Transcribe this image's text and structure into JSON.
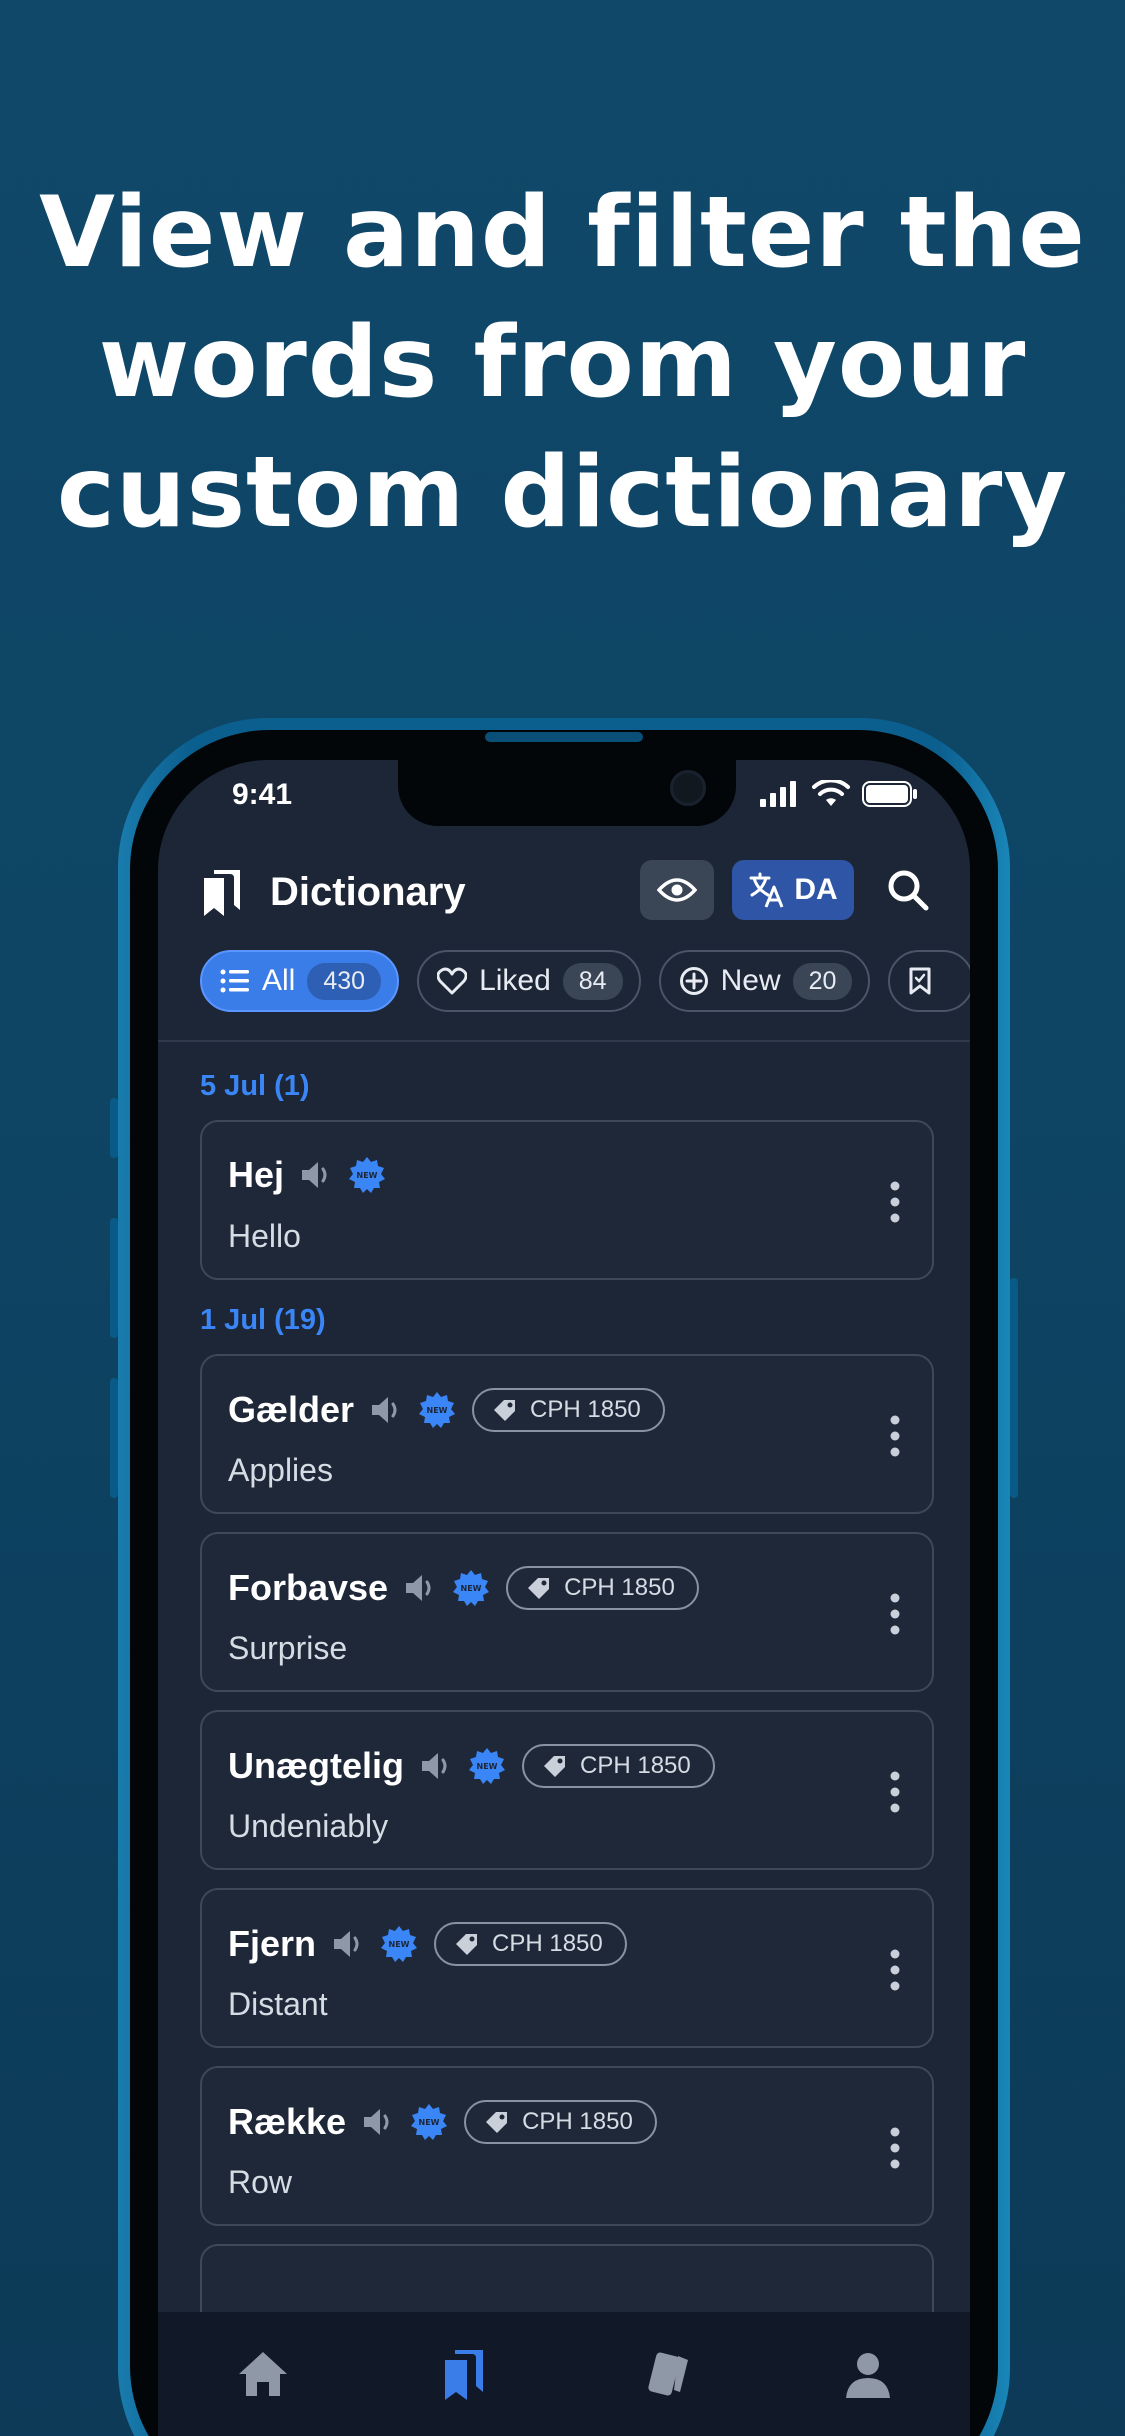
{
  "headline": {
    "line1": "View and filter the",
    "line2": "words from your",
    "line3": "custom dictionary"
  },
  "status": {
    "time": "9:41"
  },
  "header": {
    "title": "Dictionary",
    "lang_label": "DA"
  },
  "filters": [
    {
      "label": "All",
      "count": "430",
      "icon": "list-icon"
    },
    {
      "label": "Liked",
      "count": "84",
      "icon": "heart-icon"
    },
    {
      "label": "New",
      "count": "20",
      "icon": "plus-circle-icon"
    }
  ],
  "groups": [
    {
      "date": "5 Jul (1)",
      "entries": [
        {
          "word": "Hej",
          "translation": "Hello",
          "tag": ""
        }
      ]
    },
    {
      "date": "1 Jul (19)",
      "entries": [
        {
          "word": "Gælder",
          "translation": "Applies",
          "tag": "CPH 1850"
        },
        {
          "word": "Forbavse",
          "translation": "Surprise",
          "tag": "CPH 1850"
        },
        {
          "word": "Unægtelig",
          "translation": "Undeniably",
          "tag": "CPH 1850"
        },
        {
          "word": "Fjern",
          "translation": "Distant",
          "tag": "CPH 1850"
        },
        {
          "word": "Række",
          "translation": "Row",
          "tag": "CPH 1850"
        }
      ]
    }
  ],
  "tabs": [
    {
      "icon": "home-icon",
      "active": false
    },
    {
      "icon": "dictionary-icon",
      "active": true
    },
    {
      "icon": "cards-icon",
      "active": false
    },
    {
      "icon": "profile-icon",
      "active": false
    }
  ],
  "colors": {
    "background": "#0e4565",
    "screen": "#1d2636",
    "accent": "#3b7de8",
    "date_heading": "#3b86f7"
  }
}
